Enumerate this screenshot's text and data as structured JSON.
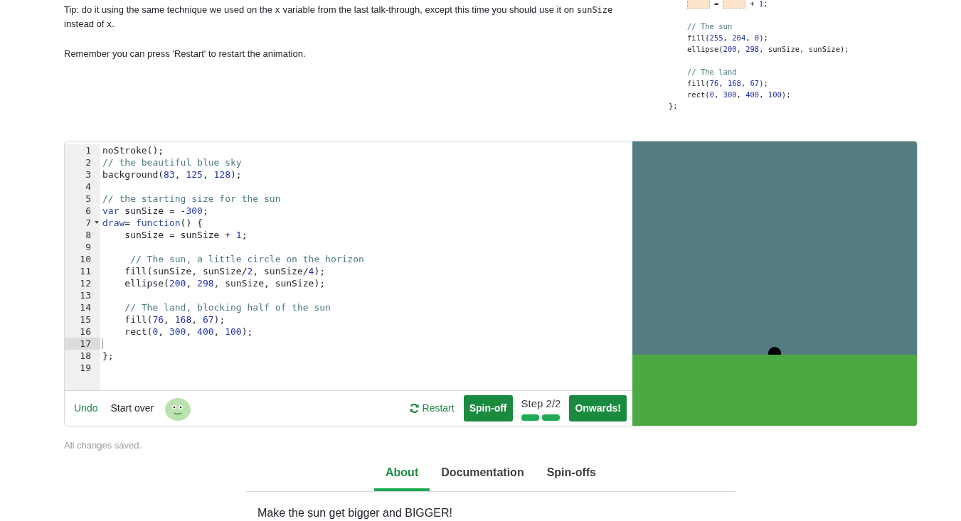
{
  "instructions": [
    {
      "parts": [
        {
          "kind": "text",
          "t": "Tip: do it using the same technique we used on the "
        },
        {
          "kind": "code",
          "t": "x"
        },
        {
          "kind": "text",
          "t": " variable from the last talk-through, except this time you should use it on "
        },
        {
          "kind": "code",
          "t": "sunSize"
        },
        {
          "kind": "text",
          "t": " instead of "
        },
        {
          "kind": "code",
          "t": "x"
        },
        {
          "kind": "text",
          "t": "."
        }
      ]
    },
    {
      "parts": [
        {
          "kind": "text",
          "t": "Remember you can press 'Restart' to restart the animation."
        }
      ]
    }
  ],
  "hint_code": {
    "blocks": [
      {
        "lines": [
          {
            "tokens": [
              {
                "kind": "blank"
              },
              {
                "kind": "plain",
                "t": "="
              },
              {
                "kind": "blank"
              },
              {
                "kind": "plain",
                "t": "+"
              },
              {
                "kind": "num",
                "t": "1"
              },
              {
                "kind": "plain",
                "t": ";"
              }
            ]
          }
        ]
      },
      {
        "lines": [
          {
            "tokens": [
              {
                "kind": "comment",
                "t": "// The sun"
              }
            ]
          },
          {
            "tokens": [
              {
                "kind": "plain",
                "t": "fill("
              },
              {
                "kind": "num",
                "t": "255"
              },
              {
                "kind": "plain",
                "t": ", "
              },
              {
                "kind": "num",
                "t": "204"
              },
              {
                "kind": "plain",
                "t": ", "
              },
              {
                "kind": "num",
                "t": "0"
              },
              {
                "kind": "plain",
                "t": ");"
              }
            ]
          },
          {
            "tokens": [
              {
                "kind": "plain",
                "t": "ellipse("
              },
              {
                "kind": "num",
                "t": "200"
              },
              {
                "kind": "plain",
                "t": ", "
              },
              {
                "kind": "num",
                "t": "298"
              },
              {
                "kind": "plain",
                "t": ", sunSize, sunSize);"
              }
            ]
          }
        ]
      },
      {
        "lines": [
          {
            "tokens": [
              {
                "kind": "comment",
                "t": "// The land"
              }
            ]
          },
          {
            "tokens": [
              {
                "kind": "plain",
                "t": "fill("
              },
              {
                "kind": "num",
                "t": "76"
              },
              {
                "kind": "plain",
                "t": ", "
              },
              {
                "kind": "num",
                "t": "168"
              },
              {
                "kind": "plain",
                "t": ", "
              },
              {
                "kind": "num",
                "t": "67"
              },
              {
                "kind": "plain",
                "t": ");"
              }
            ]
          },
          {
            "tokens": [
              {
                "kind": "plain",
                "t": "rect("
              },
              {
                "kind": "num",
                "t": "0"
              },
              {
                "kind": "plain",
                "t": ", "
              },
              {
                "kind": "num",
                "t": "300"
              },
              {
                "kind": "plain",
                "t": ", "
              },
              {
                "kind": "num",
                "t": "400"
              },
              {
                "kind": "plain",
                "t": ", "
              },
              {
                "kind": "num",
                "t": "100"
              },
              {
                "kind": "plain",
                "t": ");"
              }
            ]
          }
        ]
      }
    ],
    "closing": "};"
  },
  "editor": {
    "lines": [
      {
        "number": "1",
        "foldable": false,
        "selected": false,
        "tokens": [
          {
            "kind": "plain",
            "t": "noStroke();"
          }
        ]
      },
      {
        "number": "2",
        "foldable": false,
        "selected": false,
        "tokens": [
          {
            "kind": "comment",
            "t": "// the beautiful blue sky"
          }
        ]
      },
      {
        "number": "3",
        "foldable": false,
        "selected": false,
        "tokens": [
          {
            "kind": "plain",
            "t": "background("
          },
          {
            "kind": "num",
            "t": "83"
          },
          {
            "kind": "plain",
            "t": ", "
          },
          {
            "kind": "num",
            "t": "125"
          },
          {
            "kind": "plain",
            "t": ", "
          },
          {
            "kind": "num",
            "t": "128"
          },
          {
            "kind": "plain",
            "t": ");"
          }
        ]
      },
      {
        "number": "4",
        "foldable": false,
        "selected": false
      },
      {
        "number": "5",
        "foldable": false,
        "selected": false,
        "tokens": [
          {
            "kind": "comment",
            "t": "// the starting size for the sun"
          }
        ]
      },
      {
        "number": "6",
        "foldable": false,
        "selected": false,
        "tokens": [
          {
            "kind": "keyword",
            "t": "var"
          },
          {
            "kind": "plain",
            "t": " sunSize = -"
          },
          {
            "kind": "num",
            "t": "300"
          },
          {
            "kind": "plain",
            "t": ";"
          }
        ]
      },
      {
        "number": "7",
        "foldable": true,
        "selected": false,
        "tokens": [
          {
            "kind": "keyword",
            "t": "draw"
          },
          {
            "kind": "plain",
            "t": "= "
          },
          {
            "kind": "keyword",
            "t": "function"
          },
          {
            "kind": "plain",
            "t": "() {"
          }
        ]
      },
      {
        "number": "8",
        "foldable": false,
        "selected": false,
        "tokens": [
          {
            "kind": "plain",
            "t": "    sunSize = sunSize + "
          },
          {
            "kind": "num",
            "t": "1"
          },
          {
            "kind": "plain",
            "t": ";"
          }
        ]
      },
      {
        "number": "9",
        "foldable": false,
        "selected": false
      },
      {
        "number": "10",
        "foldable": false,
        "selected": false,
        "tokens": [
          {
            "kind": "comment",
            "t": "     // The sun, a little circle on the horizon"
          }
        ]
      },
      {
        "number": "11",
        "foldable": false,
        "selected": false,
        "tokens": [
          {
            "kind": "plain",
            "t": "    fill(sunSize, sunSize/"
          },
          {
            "kind": "num",
            "t": "2"
          },
          {
            "kind": "plain",
            "t": ", sunSize/"
          },
          {
            "kind": "num",
            "t": "4"
          },
          {
            "kind": "plain",
            "t": ");"
          }
        ]
      },
      {
        "number": "12",
        "foldable": false,
        "selected": false,
        "tokens": [
          {
            "kind": "plain",
            "t": "    ellipse("
          },
          {
            "kind": "num",
            "t": "200"
          },
          {
            "kind": "plain",
            "t": ", "
          },
          {
            "kind": "num",
            "t": "298"
          },
          {
            "kind": "plain",
            "t": ", sunSize, sunSize);"
          }
        ]
      },
      {
        "number": "13",
        "foldable": false,
        "selected": false
      },
      {
        "number": "14",
        "foldable": false,
        "selected": false,
        "tokens": [
          {
            "kind": "comment",
            "t": "    // The land, blocking half of the sun"
          }
        ]
      },
      {
        "number": "15",
        "foldable": false,
        "selected": false,
        "tokens": [
          {
            "kind": "plain",
            "t": "    fill("
          },
          {
            "kind": "num",
            "t": "76"
          },
          {
            "kind": "plain",
            "t": ", "
          },
          {
            "kind": "num",
            "t": "168"
          },
          {
            "kind": "plain",
            "t": ", "
          },
          {
            "kind": "num",
            "t": "67"
          },
          {
            "kind": "plain",
            "t": ");"
          }
        ]
      },
      {
        "number": "16",
        "foldable": false,
        "selected": false,
        "tokens": [
          {
            "kind": "plain",
            "t": "    rect("
          },
          {
            "kind": "num",
            "t": "0"
          },
          {
            "kind": "plain",
            "t": ", "
          },
          {
            "kind": "num",
            "t": "300"
          },
          {
            "kind": "plain",
            "t": ", "
          },
          {
            "kind": "num",
            "t": "400"
          },
          {
            "kind": "plain",
            "t": ", "
          },
          {
            "kind": "num",
            "t": "100"
          },
          {
            "kind": "plain",
            "t": ");"
          }
        ]
      },
      {
        "number": "17",
        "foldable": false,
        "selected": true
      },
      {
        "number": "18",
        "foldable": false,
        "selected": false,
        "tokens": [
          {
            "kind": "plain",
            "t": "};"
          }
        ]
      },
      {
        "number": "19",
        "foldable": false,
        "selected": false
      }
    ]
  },
  "toolbar": {
    "undo": "Undo",
    "start_over": "Start over",
    "restart": "Restart",
    "spin_off": "Spin-off",
    "step_label": "Step 2/2",
    "steps": [
      {
        "done": true
      },
      {
        "done": true
      }
    ],
    "next": "Onwards!"
  },
  "save_status": "All changes saved.",
  "tabs": [
    {
      "label": "About",
      "selected": true
    },
    {
      "label": "Documentation",
      "selected": false
    },
    {
      "label": "Spin-offs",
      "selected": false
    }
  ],
  "description": "Make the sun get bigger and BIGGER!"
}
